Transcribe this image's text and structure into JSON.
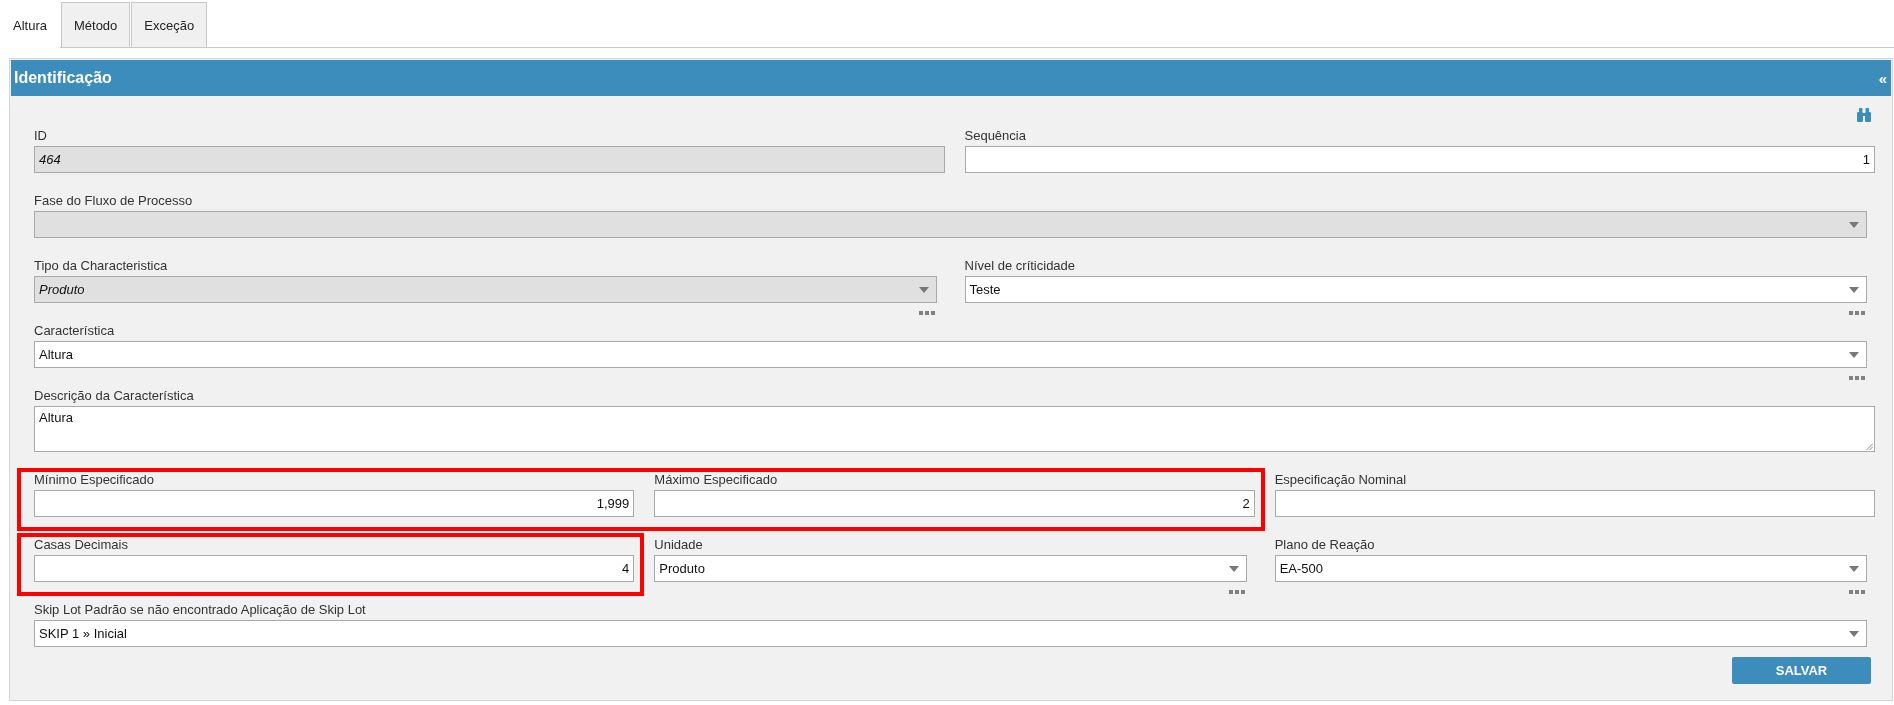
{
  "tabs": [
    {
      "label": "Altura",
      "selected": true
    },
    {
      "label": "Método",
      "selected": false
    },
    {
      "label": "Exceção",
      "selected": false
    }
  ],
  "panel": {
    "title": "Identificação",
    "collapse_symbol": "«"
  },
  "form": {
    "rows": [
      {
        "fields": [
          {
            "kind": "text",
            "label": "ID",
            "value": "464",
            "disabled": true,
            "highlighted": false
          },
          {
            "kind": "number",
            "label": "Sequência",
            "value": "1",
            "disabled": false,
            "highlighted": false
          }
        ]
      },
      {
        "fields": [
          {
            "kind": "select",
            "label": "Fase do Fluxo de Processo",
            "disabled": true,
            "highlighted": false,
            "more_button": false
          }
        ]
      },
      {
        "fields": [
          {
            "kind": "select",
            "label": "Tipo da Characteristica",
            "value": "Produto",
            "disabled": true,
            "highlighted": false,
            "more_button": true
          },
          {
            "kind": "select",
            "label": "Nível de críticidade",
            "value": "Teste",
            "disabled": false,
            "highlighted": false,
            "more_button": true
          }
        ]
      },
      {
        "fields": [
          {
            "kind": "select",
            "label": "Característica",
            "value": "Altura",
            "disabled": false,
            "highlighted": false,
            "more_button": true
          }
        ]
      },
      {
        "fields": [
          {
            "kind": "textarea",
            "label": "Descrição da Característica",
            "value": "Altura",
            "disabled": false,
            "highlighted": false
          }
        ]
      },
      {
        "fields": [
          {
            "kind": "number",
            "label": "Mínimo Especificado",
            "value": "1,999",
            "disabled": false,
            "highlighted": true
          },
          {
            "kind": "number",
            "label": "Máximo Especificado",
            "value": "2",
            "disabled": false,
            "highlighted": true
          },
          {
            "kind": "number",
            "label": "Especificação Nominal",
            "disabled": false,
            "highlighted": false
          }
        ]
      },
      {
        "fields": [
          {
            "kind": "number",
            "label": "Casas Decimais",
            "value": "4",
            "disabled": false,
            "highlighted": true
          },
          {
            "kind": "select",
            "label": "Unidade",
            "value": "Produto",
            "disabled": false,
            "highlighted": false,
            "more_button": true
          },
          {
            "kind": "select",
            "label": "Plano de Reação",
            "value": "EA-500",
            "disabled": false,
            "highlighted": false,
            "more_button": true
          }
        ]
      },
      {
        "fields": [
          {
            "kind": "select",
            "label": "Skip Lot Padrão se não encontrado Aplicação de Skip Lot",
            "value": "SKIP 1 » Inicial",
            "disabled": false,
            "highlighted": false,
            "more_button": false
          }
        ]
      }
    ]
  },
  "buttons": [
    {
      "label": "SALVAR"
    }
  ]
}
